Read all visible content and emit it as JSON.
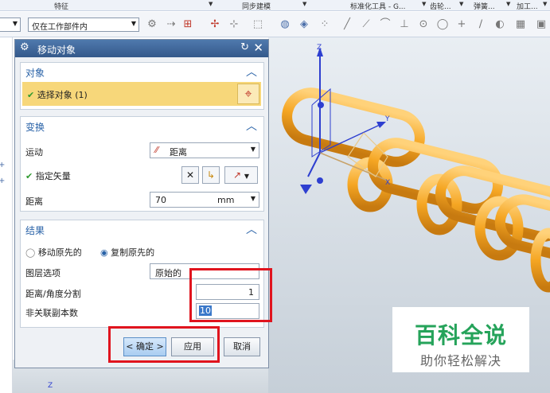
{
  "ribbon": {
    "feature": "特征",
    "sync_modeling": "同步建模",
    "std_tools": "标准化工具 - G...",
    "gear": "齿轮...",
    "spring": "弹簧...",
    "machining": "加工..."
  },
  "toolbar": {
    "scope_select": "仅在工作部件内"
  },
  "dialog": {
    "title": "移动对象",
    "object": {
      "header": "对象",
      "select_label": "选择对象 (1)"
    },
    "transform": {
      "header": "变换",
      "motion_label": "运动",
      "motion_value": "距离",
      "vector_label": "指定矢量",
      "distance_label": "距离",
      "distance_value": "70",
      "distance_unit": "mm"
    },
    "result": {
      "header": "结果",
      "move_original": "移动原先的",
      "copy_original": "复制原先的",
      "layer_label": "图层选项",
      "layer_value": "原始的",
      "divide_label": "距离/角度分割",
      "divide_value": "1",
      "copies_label": "非关联副本数",
      "copies_value": "10"
    },
    "buttons": {
      "ok": "< 确定 >",
      "apply": "应用",
      "cancel": "取消"
    }
  },
  "graphics": {
    "z_axis": "Z",
    "y_axis": "Y",
    "x_axis": "X",
    "bottom_axis": "Z"
  },
  "watermark": {
    "title": "百科全说",
    "subtitle": "助你轻松解决"
  },
  "colors": {
    "chain": "#f5a623",
    "highlight": "#f7d77a",
    "title_bar": "#3d6699",
    "red_box": "#e0141e",
    "watermark_green": "#25a35a"
  }
}
